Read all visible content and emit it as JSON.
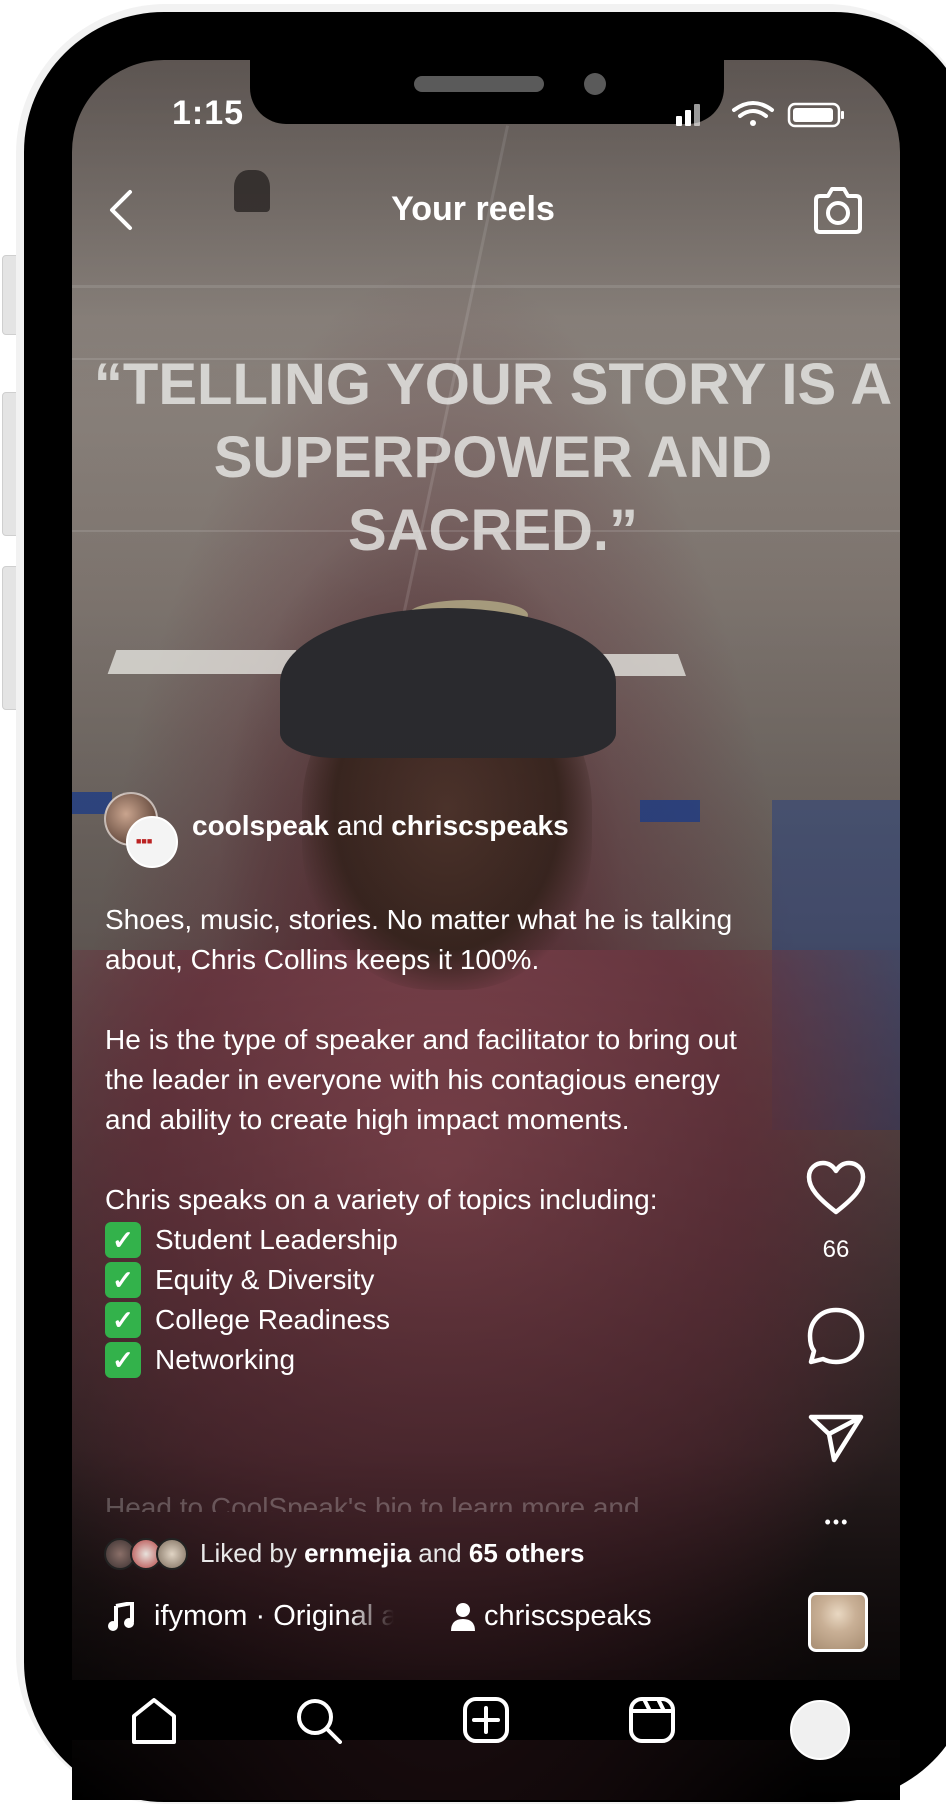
{
  "status_bar": {
    "time": "1:15"
  },
  "header": {
    "title": "Your reels"
  },
  "video_overlay": {
    "quote_line1": "“TELLING YOUR STORY IS A",
    "quote_line2": "SUPERPOWER AND SACRED.”"
  },
  "author": {
    "user1": "coolspeak",
    "joiner": " and ",
    "user2": "chriscspeaks"
  },
  "caption": {
    "para1": "Shoes, music, stories. No matter what he is talking about, Chris Collins keeps it 100%.",
    "para2": "He is the type of speaker and facilitator to bring out the leader in everyone with his contagious energy and ability to create high impact moments.",
    "topics_intro": "Chris speaks on a variety of topics including:",
    "topics": [
      "Student Leadership",
      "Equity & Diversity",
      "College Readiness",
      "Networking"
    ],
    "check_glyph": "✓",
    "truncated_line": "Head to CoolSpeak's bio to learn more and"
  },
  "likes": {
    "prefix": "Liked by ",
    "user": "ernmejia",
    "middle": " and ",
    "others": "65 others"
  },
  "audio": {
    "text": "ifymom · Original audio",
    "user": "chriscspeaks"
  },
  "actions": {
    "like_count": "66",
    "more_glyph": "•••"
  },
  "icons": {
    "back": "chevron-left-icon",
    "camera": "camera-icon",
    "like": "heart-icon",
    "comment": "comment-icon",
    "share": "send-icon",
    "more": "more-icon",
    "music": "music-note-icon",
    "person": "person-icon",
    "tabs": [
      "home-icon",
      "search-icon",
      "new-post-icon",
      "reels-icon",
      "profile-avatar"
    ]
  },
  "colors": {
    "check_green": "#33b24b",
    "text": "#ffffff"
  }
}
